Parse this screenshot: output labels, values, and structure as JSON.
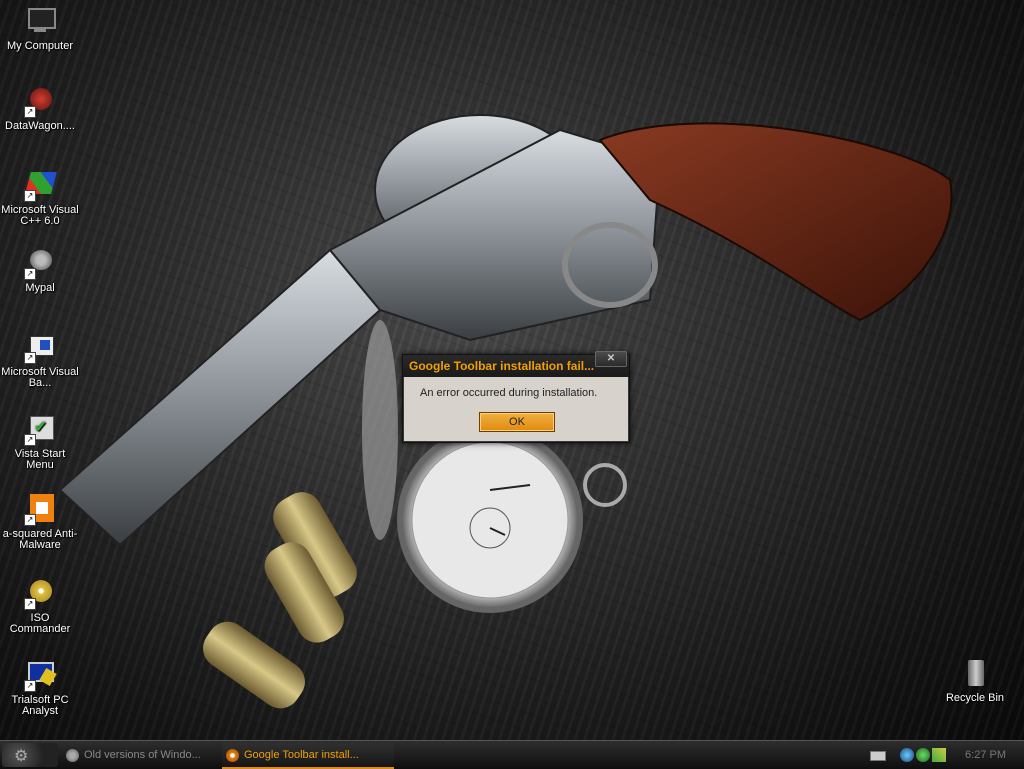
{
  "desktop": {
    "icons": [
      {
        "label": "My Computer"
      },
      {
        "label": "DataWagon...."
      },
      {
        "label": "Microsoft Visual C++ 6.0"
      },
      {
        "label": "Mypal"
      },
      {
        "label": "Microsoft Visual Ba..."
      },
      {
        "label": "Vista Start Menu"
      },
      {
        "label": "a-squared Anti-Malware"
      },
      {
        "label": "ISO Commander"
      },
      {
        "label": "Trialsoft PC Analyst"
      },
      {
        "label": "Recycle Bin"
      }
    ]
  },
  "dialog": {
    "title": "Google Toolbar installation fail...",
    "message": "An error occurred during installation.",
    "ok_label": "OK",
    "close_label": "✕"
  },
  "taskbar": {
    "tasks": [
      {
        "label": "Old versions of Windo..."
      },
      {
        "label": "Google Toolbar install..."
      }
    ],
    "clock": "6:27 PM"
  },
  "colors": {
    "accent": "#f0a000",
    "ok_button": "#e08a10"
  }
}
